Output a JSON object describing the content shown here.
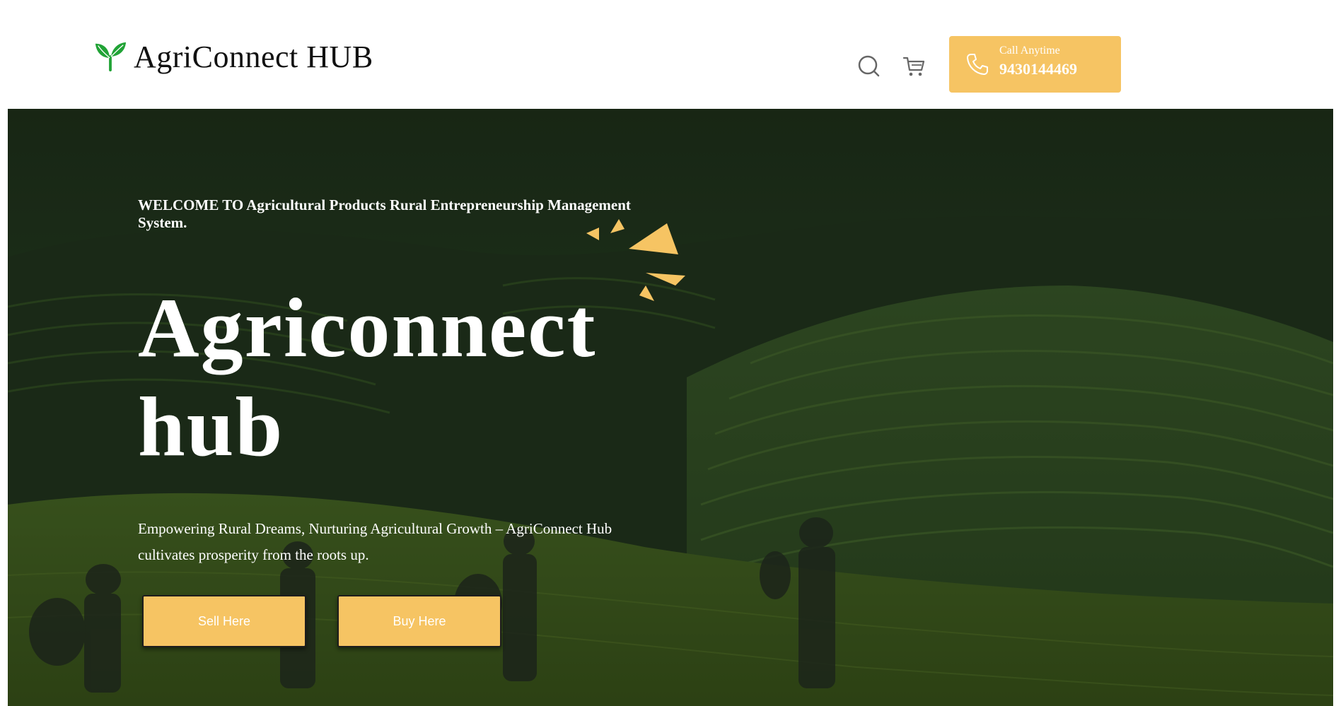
{
  "header": {
    "brand_name": "AgriConnect HUB",
    "brand_icon": "sprout-icon",
    "search_icon": "search-icon",
    "cart_icon": "cart-icon",
    "call": {
      "icon": "phone-icon",
      "label": "Call Anytime",
      "number": "9430144469"
    }
  },
  "hero": {
    "welcome": "WELCOME TO Agricultural Products Rural Entrepreneurship Management System.",
    "title_line1": "Agriconnect",
    "title_line2": "hub",
    "tagline": "Empowering Rural Dreams, Nurturing Agricultural Growth – AgriConnect Hub cultivates prosperity from the roots up.",
    "buttons": {
      "sell": "Sell Here",
      "buy": "Buy Here"
    }
  },
  "colors": {
    "accent": "#f6c463",
    "brand_green": "#21a336",
    "hero_overlay": "#1f3a1c"
  }
}
